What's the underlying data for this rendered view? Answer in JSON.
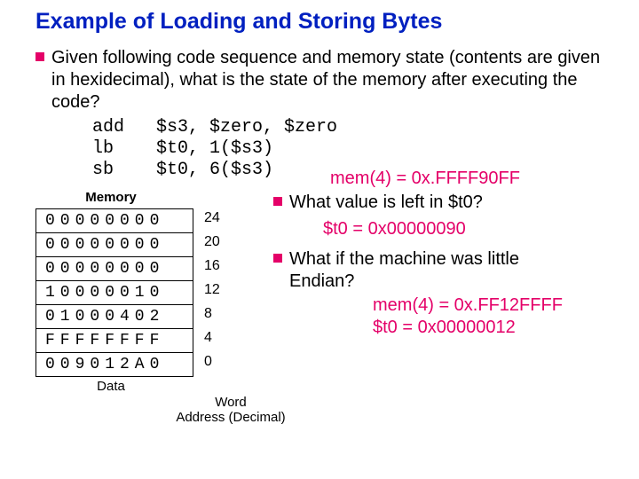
{
  "title": "Example of Loading and Storing Bytes",
  "intro": "Given following code sequence and memory state (contents are given in hexidecimal), what is the state of the memory after executing the code?",
  "code_lines": "add   $s3, $zero, $zero\nlb    $t0, 1($s3)\nsb    $t0, 6($s3)",
  "mem_note": "mem(4) = 0x.FFFF90FF",
  "memory_header": "Memory",
  "rows": [
    {
      "data": "00000000",
      "addr": "24"
    },
    {
      "data": "00000000",
      "addr": "20"
    },
    {
      "data": "00000000",
      "addr": "16"
    },
    {
      "data": "10000010",
      "addr": "12"
    },
    {
      "data": "01000402",
      "addr": "8"
    },
    {
      "data": "FFFFFFFF",
      "addr": "4"
    },
    {
      "data": "009012A0",
      "addr": "0"
    }
  ],
  "data_label": "Data",
  "word_label_1": "Word",
  "word_label_2": "Address (Decimal)",
  "q1": "What value is left in $t0?",
  "a1": "$t0 = 0x00000090",
  "q2": "What if the machine was little",
  "q2b": "Endian?",
  "a2a": "mem(4) = 0x.FF12FFFF",
  "a2b": "$t0 = 0x00000012"
}
